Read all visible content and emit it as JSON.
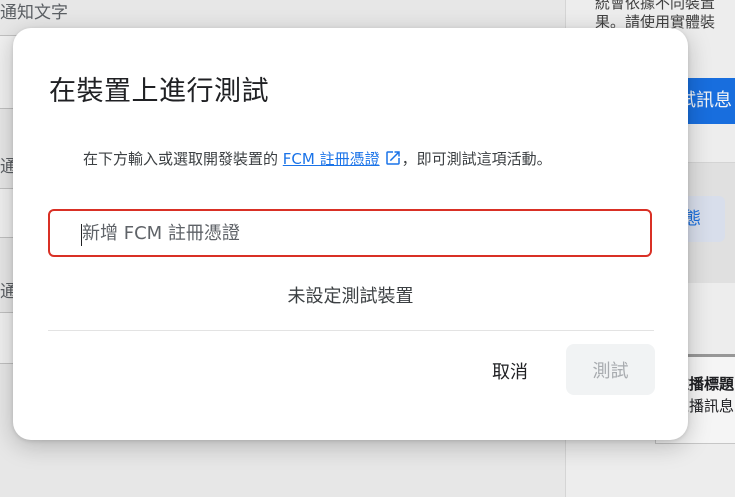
{
  "background": {
    "field_label_1": "通知文字",
    "field_label_2": "通",
    "field_label_3": "通",
    "right_text_line1": "統會依據不同裝置",
    "right_text_line2": "果。請使用實體裝",
    "right_button": "試訊息",
    "right_chip": "態",
    "notify_line1": "推播標題",
    "notify_line2": "推播訊息"
  },
  "dialog": {
    "title": "在裝置上進行測試",
    "description_prefix": "在下方輸入或選取開發裝置的 ",
    "description_link": "FCM 註冊憑證",
    "description_suffix": "，即可測試這項活動。",
    "token_placeholder": "新增 FCM 註冊憑證",
    "token_value": "",
    "empty_message": "未設定測試裝置",
    "cancel_label": "取消",
    "test_label": "測試"
  },
  "colors": {
    "link": "#1a73e8",
    "error_border": "#d93025",
    "disabled_text": "#a8abaf"
  }
}
